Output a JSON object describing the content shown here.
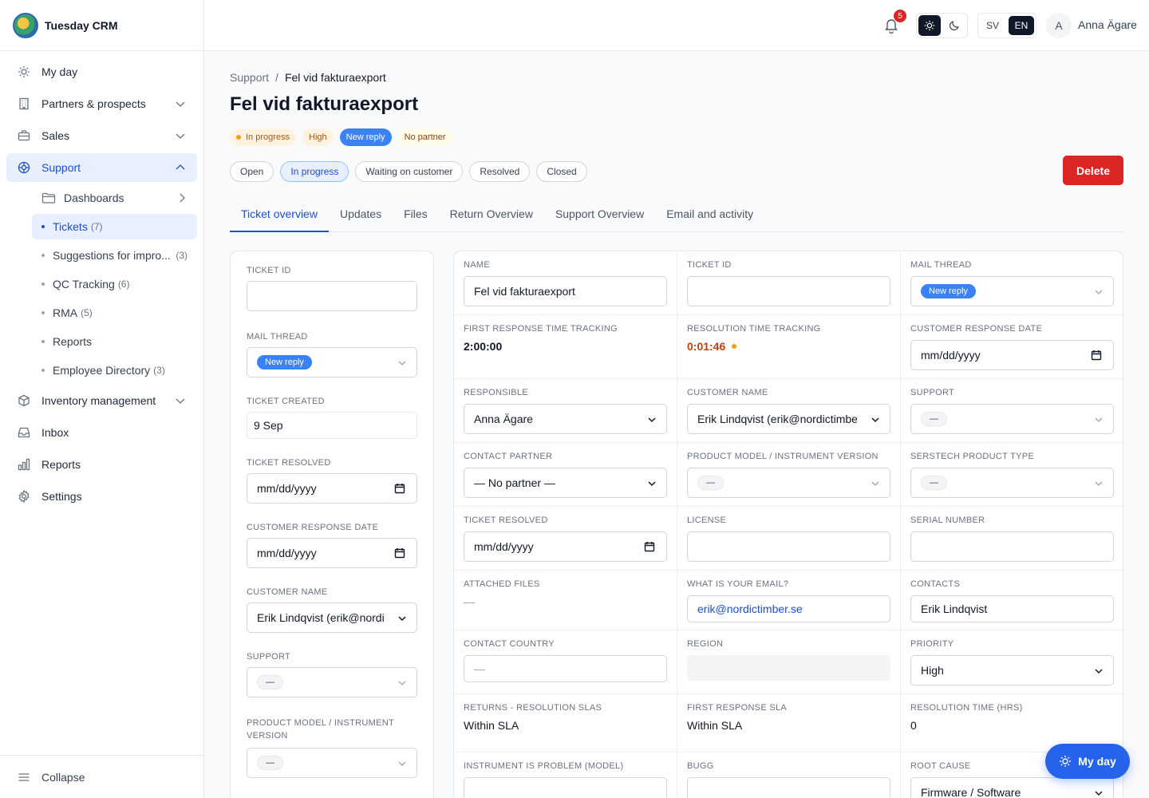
{
  "app": {
    "name": "Tuesday CRM"
  },
  "sidebar": {
    "items": [
      {
        "label": "My day",
        "icon": "sun-icon"
      },
      {
        "label": "Partners & prospects",
        "icon": "building-icon"
      },
      {
        "label": "Sales",
        "icon": "briefcase-icon"
      },
      {
        "label": "Support",
        "icon": "lifebuoy-icon"
      },
      {
        "label": "Inventory management",
        "icon": "box-icon"
      },
      {
        "label": "Inbox",
        "icon": "inbox-icon"
      },
      {
        "label": "Reports",
        "icon": "bar-chart-icon"
      },
      {
        "label": "Settings",
        "icon": "gear-icon"
      }
    ],
    "support_children": [
      {
        "label": "Dashboards",
        "count": ""
      },
      {
        "label": "Tickets",
        "count": "(7)"
      },
      {
        "label": "Suggestions for impro...",
        "count": "(3)"
      },
      {
        "label": "QC Tracking",
        "count": "(6)"
      },
      {
        "label": "RMA",
        "count": "(5)"
      },
      {
        "label": "Reports",
        "count": ""
      },
      {
        "label": "Employee Directory",
        "count": "(3)"
      }
    ],
    "collapse_label": "Collapse"
  },
  "topbar": {
    "notification_count": "5",
    "lang_sv": "SV",
    "lang_en": "EN",
    "avatar_initial": "A",
    "user_name": "Anna Ägare"
  },
  "breadcrumb": {
    "parent": "Support",
    "sep": "/",
    "current": "Fel vid fakturaexport"
  },
  "page_title": "Fel vid fakturaexport",
  "badges": {
    "status": "In progress",
    "priority": "High",
    "mail": "New reply",
    "partner": "No partner"
  },
  "statuses": [
    "Open",
    "In progress",
    "Waiting on customer",
    "Resolved",
    "Closed"
  ],
  "delete_label": "Delete",
  "tabs": [
    "Ticket overview",
    "Updates",
    "Files",
    "Return Overview",
    "Support Overview",
    "Email and activity"
  ],
  "left_panel": {
    "ticket_id": {
      "label": "TICKET ID",
      "value": ""
    },
    "mail_thread": {
      "label": "MAIL THREAD",
      "value": "New reply"
    },
    "ticket_created": {
      "label": "TICKET CREATED",
      "value": "9 Sep"
    },
    "ticket_resolved": {
      "label": "TICKET RESOLVED",
      "value": "mm/dd/yyyy"
    },
    "customer_response_date": {
      "label": "CUSTOMER RESPONSE DATE",
      "value": "mm/dd/yyyy"
    },
    "customer_name": {
      "label": "CUSTOMER NAME",
      "value": "Erik Lindqvist (erik@nordi"
    },
    "support": {
      "label": "SUPPORT",
      "value": "—"
    },
    "product_model": {
      "label": "PRODUCT MODEL / INSTRUMENT VERSION",
      "value": "—"
    }
  },
  "grid": {
    "name": {
      "label": "NAME",
      "value": "Fel vid fakturaexport"
    },
    "ticket_id": {
      "label": "TICKET ID",
      "value": ""
    },
    "mail_thread": {
      "label": "MAIL THREAD",
      "value": "New reply"
    },
    "first_response_tracking": {
      "label": "FIRST RESPONSE TIME TRACKING",
      "value": "2:00:00"
    },
    "resolution_tracking": {
      "label": "RESOLUTION TIME TRACKING",
      "value": "0:01:46"
    },
    "customer_response_date": {
      "label": "CUSTOMER RESPONSE DATE",
      "value": "mm/dd/yyyy"
    },
    "responsible": {
      "label": "RESPONSIBLE",
      "value": "Anna Ägare"
    },
    "customer_name": {
      "label": "CUSTOMER NAME",
      "value": "Erik Lindqvist (erik@nordictimbe"
    },
    "support": {
      "label": "SUPPORT",
      "value": "—"
    },
    "contact_partner": {
      "label": "CONTACT PARTNER",
      "value": "— No partner —"
    },
    "product_model": {
      "label": "PRODUCT MODEL / INSTRUMENT VERSION",
      "value": "—"
    },
    "serstech_type": {
      "label": "SERSTECH PRODUCT TYPE",
      "value": "—"
    },
    "ticket_resolved": {
      "label": "TICKET RESOLVED",
      "value": "mm/dd/yyyy"
    },
    "license": {
      "label": "LICENSE",
      "value": ""
    },
    "serial_number": {
      "label": "SERIAL NUMBER",
      "value": ""
    },
    "attached_files": {
      "label": "ATTACHED FILES",
      "value": "—"
    },
    "email": {
      "label": "WHAT IS YOUR EMAIL?",
      "value": "erik@nordictimber.se"
    },
    "contacts": {
      "label": "CONTACTS",
      "value": "Erik Lindqvist"
    },
    "contact_country": {
      "label": "CONTACT COUNTRY",
      "value": "—"
    },
    "region": {
      "label": "REGION",
      "value": ""
    },
    "priority": {
      "label": "PRIORITY",
      "value": "High"
    },
    "returns_sla": {
      "label": "RETURNS - RESOLUTION SLAS",
      "value": "Within SLA"
    },
    "first_response_sla": {
      "label": "FIRST RESPONSE SLA",
      "value": "Within SLA"
    },
    "resolution_hours": {
      "label": "RESOLUTION TIME (HRS)",
      "value": "0"
    },
    "instrument_problem": {
      "label": "INSTRUMENT IS PROBLEM (MODEL)",
      "value": ""
    },
    "bugg": {
      "label": "BUGG",
      "value": ""
    },
    "root_cause": {
      "label": "ROOT CAUSE",
      "value": "Firmware / Software"
    }
  },
  "my_day_button": "My day"
}
